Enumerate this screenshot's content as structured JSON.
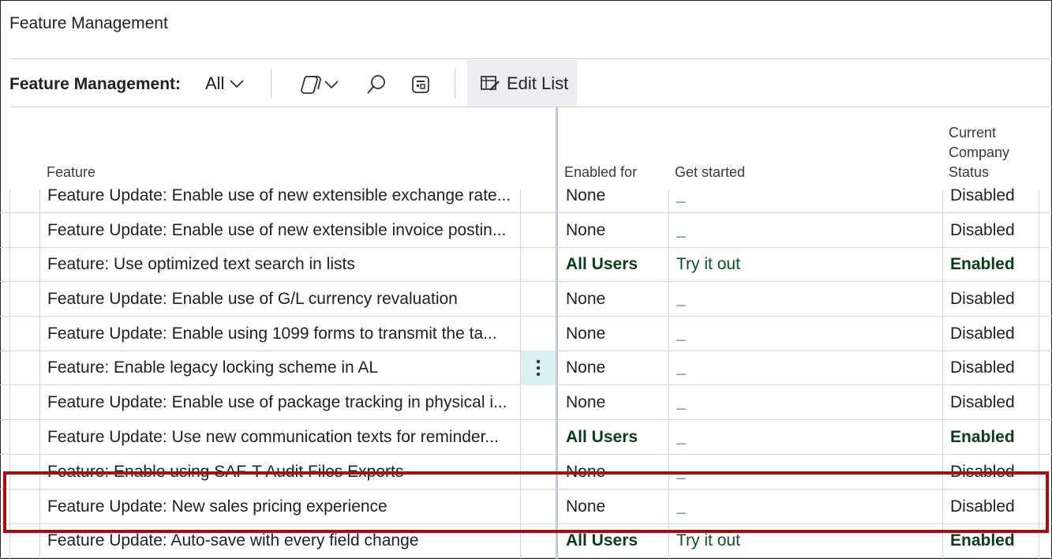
{
  "page": {
    "title": "Feature Management"
  },
  "toolbar": {
    "label": "Feature Management:",
    "view": "All",
    "icons": [
      "copilot-icon",
      "chevron-down-icon",
      "search-icon",
      "filter-pane-icon"
    ],
    "edit_list_label": "Edit List"
  },
  "columns": {
    "feature": "Feature",
    "enabled_for": "Enabled for",
    "get_started": "Get started",
    "status_line1": "Current",
    "status_line2": "Company",
    "status_line3": "Status"
  },
  "rows": [
    {
      "feature": "Feature Update: Enable use of new extensible exchange rate...",
      "enabled_for": "None",
      "get_started": "_",
      "status": "Disabled"
    },
    {
      "feature": "Feature Update: Enable use of new extensible invoice postin...",
      "enabled_for": "None",
      "get_started": "_",
      "status": "Disabled"
    },
    {
      "feature": "Feature: Use optimized text search in lists",
      "enabled_for": "All Users",
      "get_started": "Try it out",
      "status": "Enabled"
    },
    {
      "feature": "Feature Update: Enable use of G/L currency revaluation",
      "enabled_for": "None",
      "get_started": "_",
      "status": "Disabled"
    },
    {
      "feature": "Feature Update: Enable using 1099 forms to transmit the ta...",
      "enabled_for": "None",
      "get_started": "_",
      "status": "Disabled"
    },
    {
      "feature": "Feature: Enable legacy locking scheme in AL",
      "enabled_for": "None",
      "get_started": "_",
      "status": "Disabled"
    },
    {
      "feature": "Feature Update: Enable use of package tracking in physical i...",
      "enabled_for": "None",
      "get_started": "_",
      "status": "Disabled"
    },
    {
      "feature": "Feature Update: Use new communication texts for reminder...",
      "enabled_for": "All Users",
      "get_started": "_",
      "status": "Enabled"
    },
    {
      "feature": "Feature: Enable using SAF-T Audit Files Exports",
      "enabled_for": "None",
      "get_started": "_",
      "status": "Disabled"
    },
    {
      "feature": "Feature Update: New sales pricing experience",
      "enabled_for": "None",
      "get_started": "_",
      "status": "Disabled"
    },
    {
      "feature": "Feature Update: Auto-save with every field change",
      "enabled_for": "All Users",
      "get_started": "Try it out",
      "status": "Enabled"
    }
  ],
  "colors": {
    "highlight": "#a40e0e",
    "enabled_text": "#0b3d1c",
    "link": "#0b4f26",
    "row_action_bg": "#dcf0f3"
  }
}
